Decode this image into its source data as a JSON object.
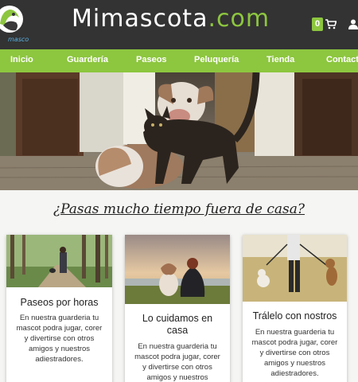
{
  "header": {
    "title_main": "Mimascota",
    "title_tld": ".com",
    "logo_text": "mascota",
    "cart_count": "0"
  },
  "nav": {
    "items": [
      "Inicio",
      "Guardería",
      "Paseos",
      "Peluquería",
      "Tienda",
      "Contacto"
    ]
  },
  "hero": {
    "alt": "dog-and-cat-photo"
  },
  "section": {
    "headline": "¿Pasas mucho tiempo fuera de casa?"
  },
  "cards": [
    {
      "title": "Paseos por horas",
      "text": [
        "En nuestra guarderia tu",
        "mascot podra jugar, corer",
        "y divertirse con otros",
        "amigos y nuestros",
        "adiestradores."
      ]
    },
    {
      "title_lines": [
        "Lo cuidamos en",
        "casa"
      ],
      "text": [
        "En nuestra guarderia tu",
        "mascot podra jugar, corer",
        "y divertirse con otros",
        "amigos y nuestros"
      ]
    },
    {
      "title": "Trálelo con nostros",
      "text": [
        "En nuestra guarderia tu",
        "mascot podra jugar, corer",
        "y divertirse con otros",
        "amigos y nuestros",
        "adiestradores."
      ]
    }
  ],
  "colors": {
    "header_bg": "#333333",
    "accent": "#8dc63f"
  }
}
